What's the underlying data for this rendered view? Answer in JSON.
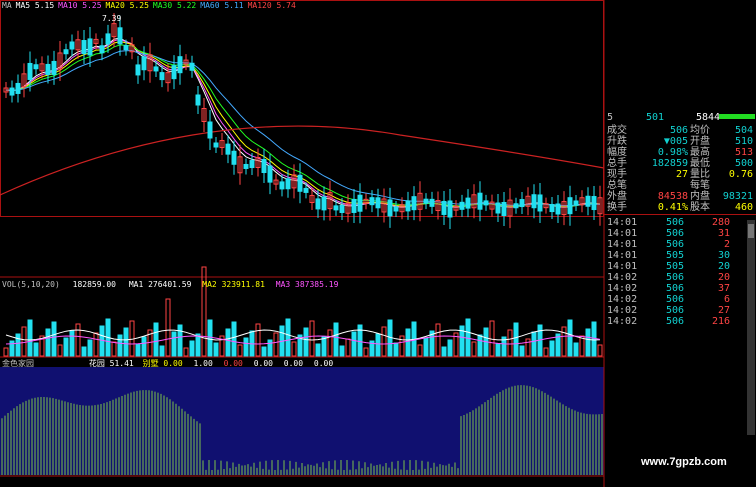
{
  "legend_ma": [
    {
      "label": "MA",
      "value": "",
      "color": "#c0c0c0"
    },
    {
      "label": "MA5",
      "value": "5.15",
      "color": "#ffffff"
    },
    {
      "label": "MA10",
      "value": "5.25",
      "color": "#ff55ff"
    },
    {
      "label": "MA20",
      "value": "5.25",
      "color": "#ffff00"
    },
    {
      "label": "MA30",
      "value": "5.22",
      "color": "#22ff22"
    },
    {
      "label": "MA60",
      "value": "5.11",
      "color": "#44aaff"
    },
    {
      "label": "MA120",
      "value": "5.74",
      "color": "#ff4444"
    }
  ],
  "price_high_label": "7.39",
  "vol_legend": {
    "title": "VOL(5,10,20)",
    "vol": "182859.00",
    "ma1_label": "MA1",
    "ma1": "276401.59",
    "ma2_label": "MA2",
    "ma2": "323911.81",
    "ma3_label": "MA3",
    "ma3": "387385.19"
  },
  "indicator_legend": {
    "title": "金色家园",
    "item1_label": "花园",
    "item1": "51.41",
    "item2_label": "别墅",
    "item2": "0.00",
    "zeros": [
      "1.00",
      "0.00",
      "0.00",
      "0.00",
      "0.00"
    ]
  },
  "side_header": {
    "code": "5",
    "price": "501",
    "amount": "5844"
  },
  "quote_rows": [
    {
      "l": "成交",
      "v": "506",
      "vc": "#11d0d0",
      "l2": "均价",
      "v2": "504",
      "v2c": "#11d0d0"
    },
    {
      "l": "升跌",
      "v": "▼005",
      "vc": "#11d0d0",
      "l2": "开盘",
      "v2": "510",
      "v2c": "#11d0d0"
    },
    {
      "l": "幅度",
      "v": "0.98%",
      "vc": "#11d0d0",
      "l2": "最高",
      "v2": "513",
      "v2c": "#ff4444"
    },
    {
      "l": "总手",
      "v": "182859",
      "vc": "#11d0d0",
      "l2": "最低",
      "v2": "500",
      "v2c": "#11d0d0"
    },
    {
      "l": "现手",
      "v": "27",
      "vc": "#ffff00",
      "l2": "量比",
      "v2": "0.76",
      "v2c": "#ffff00"
    },
    {
      "l": "总笔",
      "v": "",
      "vc": "#c0c0c0",
      "l2": "每笔",
      "v2": "",
      "v2c": "#c0c0c0"
    },
    {
      "l": "外盘",
      "v": "84538",
      "vc": "#ff4444",
      "l2": "内盘",
      "v2": "98321",
      "v2c": "#11d0d0"
    },
    {
      "l": "换手",
      "v": "0.41%",
      "vc": "#ffff00",
      "l2": "股本",
      "v2": "460",
      "v2c": "#ffff00"
    }
  ],
  "ticks": [
    {
      "t": "14:01",
      "p": "506",
      "v": "280",
      "vc": "#ff4444"
    },
    {
      "t": "14:01",
      "p": "506",
      "v": "31",
      "vc": "#ff4444"
    },
    {
      "t": "14:01",
      "p": "506",
      "v": "2",
      "vc": "#ff4444"
    },
    {
      "t": "14:01",
      "p": "505",
      "v": "30",
      "vc": "#11d0d0"
    },
    {
      "t": "14:01",
      "p": "505",
      "v": "20",
      "vc": "#11d0d0"
    },
    {
      "t": "14:02",
      "p": "506",
      "v": "20",
      "vc": "#ff4444"
    },
    {
      "t": "14:02",
      "p": "506",
      "v": "37",
      "vc": "#ff4444"
    },
    {
      "t": "14:02",
      "p": "506",
      "v": "6",
      "vc": "#ff4444"
    },
    {
      "t": "14:02",
      "p": "506",
      "v": "27",
      "vc": "#ff4444"
    },
    {
      "t": "14:02",
      "p": "506",
      "v": "216",
      "vc": "#ff4444"
    }
  ],
  "watermark": "www.7gpzb.com",
  "colors": {
    "up": "#ff4444",
    "down": "#22e0f0",
    "grid": "#aa1111",
    "indicator_bg": "#101070",
    "indicator_line": "#7bc24a"
  }
}
